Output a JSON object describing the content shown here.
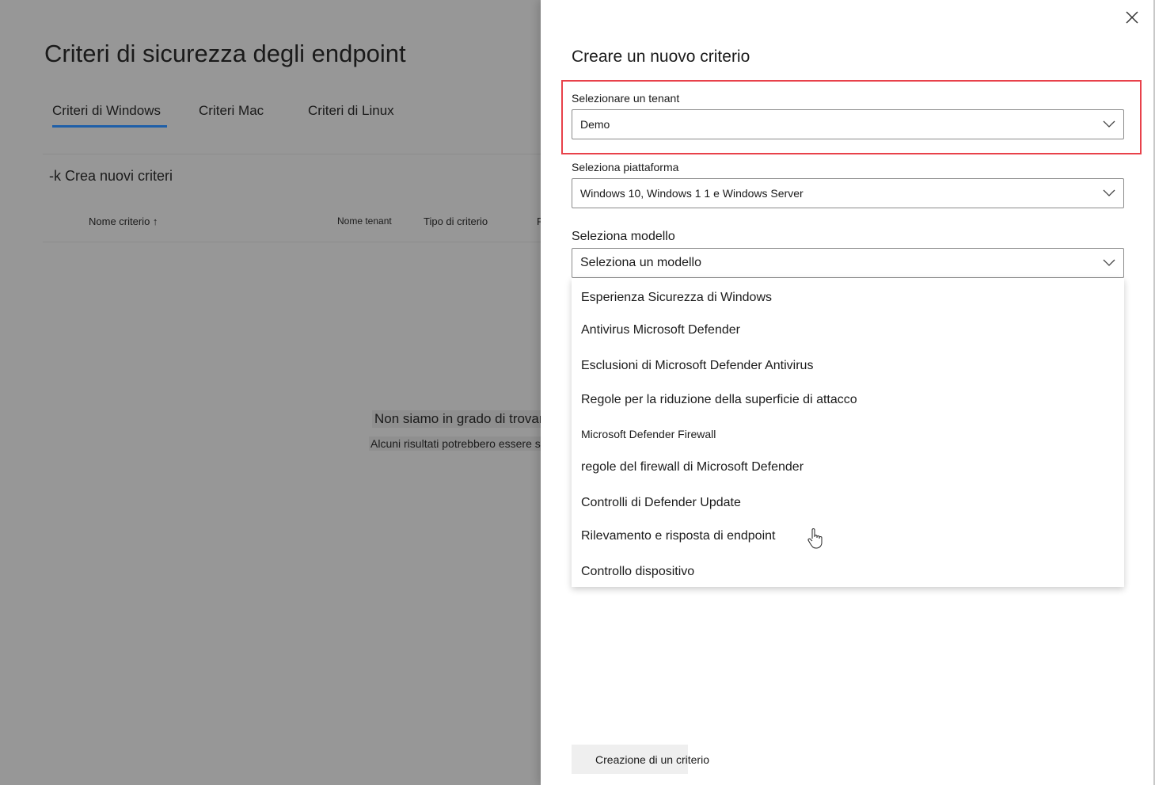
{
  "background": {
    "title": "Criteri di sicurezza degli endpoint",
    "tabs": [
      {
        "label": "Criteri di Windows",
        "active": true
      },
      {
        "label": "Criteri Mac",
        "active": false
      },
      {
        "label": "Criteri di Linux",
        "active": false
      }
    ],
    "create_label": "-k Crea nuovi criteri",
    "columns": [
      "Nome criterio",
      "Nome tenant",
      "Tipo di criterio",
      "P"
    ],
    "empty_title": "Non siamo in grado di trovare",
    "empty_subtitle": "Alcuni risultati potrebbero essere stati"
  },
  "panel": {
    "title": "Creare un nuovo criterio",
    "tenant": {
      "label": "Selezionare un tenant",
      "value": "Demo"
    },
    "platform": {
      "label": "Seleziona piattaforma",
      "value": "Windows 10, Windows 1 1 e Windows Server"
    },
    "template": {
      "label": "Seleziona modello",
      "placeholder": "Seleziona un modello",
      "options": [
        "Esperienza Sicurezza di Windows",
        "Antivirus Microsoft Defender",
        "Esclusioni di Microsoft Defender Antivirus",
        "Regole per la riduzione della superficie di attacco",
        "Microsoft Defender Firewall",
        "regole del firewall di Microsoft Defender",
        "Controlli di Defender Update",
        "Rilevamento e risposta di endpoint",
        "Controllo dispositivo"
      ]
    },
    "create_button": "Creazione di un criterio"
  },
  "colors": {
    "highlight": "#e8414a",
    "tab_underline": "#1f5fa8",
    "overlay": "#979797"
  }
}
